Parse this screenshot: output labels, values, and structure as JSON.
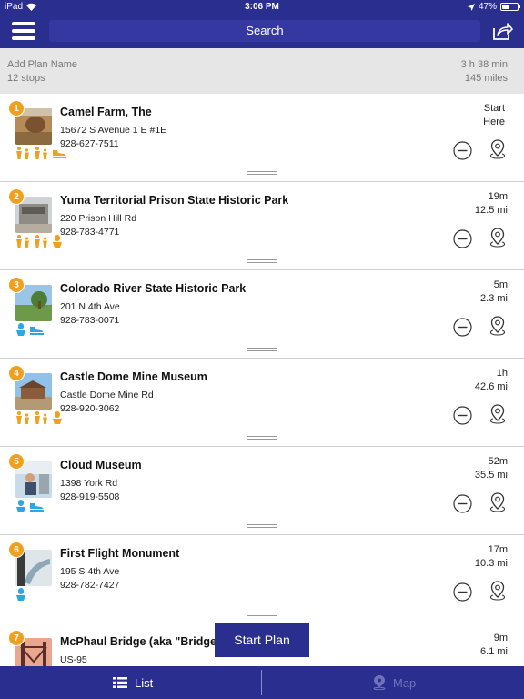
{
  "status_bar": {
    "device": "iPad",
    "time": "3:06 PM",
    "battery": "47%",
    "battery_level": 0.47
  },
  "navbar": {
    "search_label": "Search"
  },
  "plan": {
    "name_placeholder": "Add Plan Name",
    "stops": "12 stops",
    "duration": "3 h 38 min",
    "distance": "145 miles"
  },
  "stops": [
    {
      "num": "1",
      "name": "Camel Farm, The",
      "address": "15672 S Avenue 1 E #1E",
      "phone": "928-627-7511",
      "time": "Start",
      "dist": "Here",
      "amenities": [
        "family-icon",
        "family-icon",
        "shoe-icon"
      ]
    },
    {
      "num": "2",
      "name": "Yuma Territorial Prison State Historic Park",
      "address": "220 Prison Hill Rd",
      "phone": "928-783-4771",
      "time": "19m",
      "dist": "12.5 mi",
      "amenities": [
        "family-icon",
        "family-icon",
        "person-icon"
      ]
    },
    {
      "num": "3",
      "name": "Colorado River State Historic Park",
      "address": "201 N 4th Ave",
      "phone": "928-783-0071",
      "time": "5m",
      "dist": "2.3 mi",
      "amenities": [
        "person-icon",
        "shoe-icon"
      ]
    },
    {
      "num": "4",
      "name": "Castle Dome Mine Museum",
      "address": "Castle Dome Mine Rd",
      "phone": "928-920-3062",
      "time": "1h",
      "dist": "42.6 mi",
      "amenities": [
        "family-icon",
        "family-icon",
        "person-icon"
      ]
    },
    {
      "num": "5",
      "name": "Cloud Museum",
      "address": "1398 York Rd",
      "phone": "928-919-5508",
      "time": "52m",
      "dist": "35.5 mi",
      "amenities": [
        "person-icon",
        "shoe-icon"
      ]
    },
    {
      "num": "6",
      "name": "First Flight Monument",
      "address": "195 S 4th Ave",
      "phone": "928-782-7427",
      "time": "17m",
      "dist": "10.3 mi",
      "amenities": [
        "person-icon"
      ]
    },
    {
      "num": "7",
      "name": "McPhaul Bridge (aka \"Bridge",
      "address": "US-95",
      "phone": "",
      "time": "9m",
      "dist": "6.1 mi",
      "amenities": []
    }
  ],
  "start_plan_label": "Start Plan",
  "tabs": {
    "list": "List",
    "map": "Map"
  },
  "colors": {
    "brand": "#2a2f8f",
    "badge": "#f0a01f",
    "amenity_orange": "#f0a01f",
    "amenity_blue": "#2ea6e0"
  }
}
